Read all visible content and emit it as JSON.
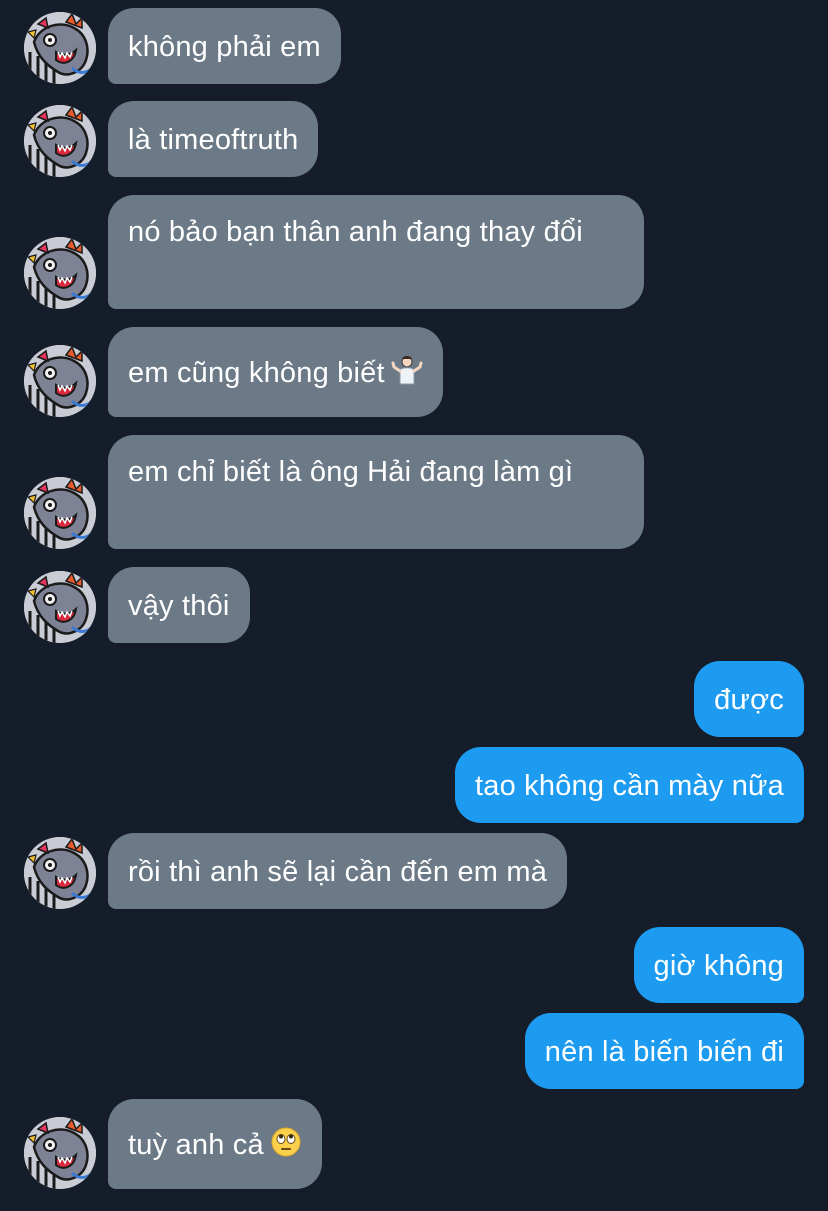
{
  "conversation": {
    "messages": [
      {
        "sender": "other",
        "text": "không phải em"
      },
      {
        "sender": "other",
        "text": "là timeoftruth"
      },
      {
        "sender": "other",
        "text": "nó bảo bạn thân anh đang thay đổi"
      },
      {
        "sender": "other",
        "text": "em cũng không biết",
        "emoji": "person-shrugging-emoji"
      },
      {
        "sender": "other",
        "text": "em chỉ biết là ông Hải đang làm gì"
      },
      {
        "sender": "other",
        "text": "vậy thôi"
      },
      {
        "sender": "me",
        "text": "được"
      },
      {
        "sender": "me",
        "text": "tao không cần mày nữa"
      },
      {
        "sender": "other",
        "text": "rồi thì anh sẽ lại cần đến em mà"
      },
      {
        "sender": "me",
        "text": "giờ không"
      },
      {
        "sender": "me",
        "text": "nên là biến biến đi"
      },
      {
        "sender": "other",
        "text": "tuỳ anh cả",
        "emoji": "face-with-rolling-eyes-emoji"
      }
    ]
  },
  "colors": {
    "background": "#151d2a",
    "incoming_bubble": "#6c7987",
    "outgoing_bubble": "#1d9bf0",
    "text": "#ffffff"
  },
  "icons": {
    "avatar": "dragon-avatar-icon"
  }
}
